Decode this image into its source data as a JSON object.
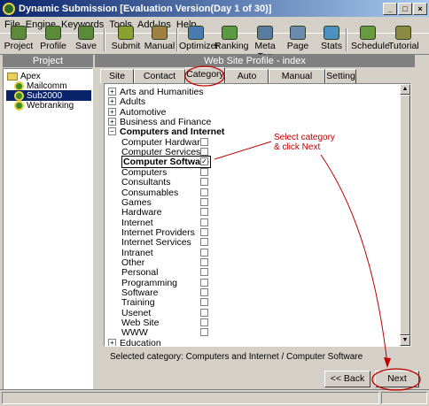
{
  "window": {
    "title": "Dynamic Submission [Evaluation Version(Day 1 of 30)]",
    "controls": [
      "_",
      "□",
      "×"
    ]
  },
  "menu": [
    "File",
    "Engine",
    "Keywords",
    "Tools",
    "Add-Ins",
    "Help"
  ],
  "toolbar": [
    {
      "label": "Project",
      "icon": "project-icon",
      "color": "#5a8a3a"
    },
    {
      "label": "Profile",
      "icon": "profile-icon",
      "color": "#5a8a3a"
    },
    {
      "label": "Save",
      "icon": "save-icon",
      "color": "#5a8a3a"
    },
    {
      "label": "Submit",
      "icon": "submit-icon",
      "color": "#8aa030"
    },
    {
      "label": "Manual",
      "icon": "manual-icon",
      "color": "#a08040"
    },
    {
      "label": "Optimizer",
      "icon": "optimizer-icon",
      "color": "#4a7ab0"
    },
    {
      "label": "Ranking",
      "icon": "ranking-icon",
      "color": "#5a9a40"
    },
    {
      "label": "Meta Tag",
      "icon": "meta-tag-icon",
      "color": "#5a7aa0"
    },
    {
      "label": "Page",
      "icon": "page-icon",
      "color": "#6a8ab0"
    },
    {
      "label": "Stats",
      "icon": "stats-icon",
      "color": "#4a90c0"
    },
    {
      "label": "Schedule",
      "icon": "schedule-icon",
      "color": "#6a9a40"
    },
    {
      "label": "Tutorial",
      "icon": "tutorial-icon",
      "color": "#8a8a40"
    }
  ],
  "project": {
    "header": "Project",
    "root": "Apex",
    "items": [
      "Mailcomm",
      "Sub2000",
      "Webranking"
    ],
    "selected": "Sub2000"
  },
  "profile": {
    "header": "Web Site Profile - index",
    "tabs": [
      "Site Info",
      "Contact Details",
      "Category",
      "Auto Engines",
      "Manual Engines",
      "Setting"
    ],
    "active_tab": "Category"
  },
  "categories": {
    "top_before": [
      "Arts and Humanities",
      "Adults",
      "Automotive",
      "Business and Finance"
    ],
    "expanded": "Computers and Internet",
    "subs": [
      "Computer Hardware",
      "Computer Services",
      "Computer Software",
      "Computers",
      "Consultants",
      "Consumables",
      "Games",
      "Hardware",
      "Internet",
      "Internet Providers",
      "Internet Services",
      "Intranet",
      "Other",
      "Personal",
      "Programming",
      "Software",
      "Training",
      "Usenet",
      "Web Site",
      "WWW"
    ],
    "checked": "Computer Software",
    "top_after": [
      "Education"
    ]
  },
  "selected_category_text": "Selected category: Computers and Internet / Computer Software",
  "annotation": {
    "line1": "Select category",
    "line2": "& click Next",
    "color": "#c00000"
  },
  "buttons": {
    "back": "<< Back",
    "next": "Next"
  }
}
